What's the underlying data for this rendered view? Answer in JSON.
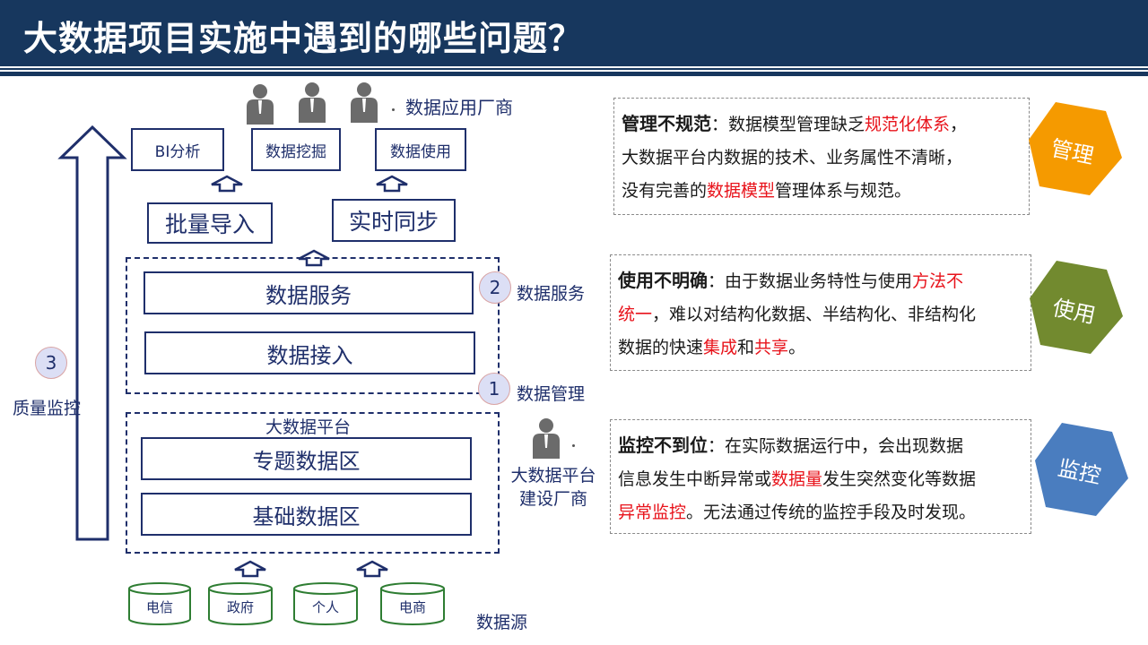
{
  "title": "大数据项目实施中遇到的哪些问题？",
  "diagram": {
    "vendor_app_label": "数据应用厂商",
    "apps": [
      "BI分析",
      "数据挖掘",
      "数据使用"
    ],
    "sync": [
      "批量导入",
      "实时同步"
    ],
    "service_box": "数据服务",
    "access_box": "数据接入",
    "platform_label": "大数据平台",
    "topic_box": "专题数据区",
    "base_box": "基础数据区",
    "sources": [
      "电信",
      "政府",
      "个人",
      "电商"
    ],
    "source_label": "数据源",
    "markers": [
      {
        "num": "2",
        "label": "数据服务"
      },
      {
        "num": "1",
        "label": "数据管理"
      },
      {
        "num": "3",
        "label": "质量监控"
      }
    ],
    "platform_vendor_label": "大数据平台建设厂商",
    "platform_vendor_lines": [
      "大数据平台",
      "建设厂商"
    ]
  },
  "issues": [
    {
      "keyword": "管理不规范",
      "sep": "：",
      "line1a": "数据模型管理缺乏",
      "line1red": "规范化体系",
      "line1b": "，",
      "line2": "大数据平台内数据的技术、业务属性不清晰，",
      "line3a": "没有完善的",
      "line3red": "数据模型",
      "line3b": "管理体系与规范。",
      "tag": "管理",
      "color": "#f59a00"
    },
    {
      "keyword": "使用不明确",
      "sep": "：",
      "line1a": "由于数据业务特性与使用",
      "line1red": "方法不",
      "line2red": "统一",
      "line2b": "，难以对结构化数据、半结构化、非结构化",
      "line3a": "数据的快速",
      "line3red": "集成",
      "line3b": "和",
      "line3red2": "共享",
      "line3c": "。",
      "tag": "使用",
      "color": "#728a2f"
    },
    {
      "keyword": "监控不到位",
      "sep": "：",
      "line1a": "在实际数据运行中，会出现数据",
      "line2a": "信息发生中断异常或",
      "line2red": "数据量",
      "line2b": "发生突然变化等数据",
      "line3red": "异常监控",
      "line3b": "。无法通过传统的监控手段及时发现。",
      "tag": "监控",
      "color": "#4a7dbf"
    }
  ],
  "colors": {
    "header_bg": "#17375e",
    "diagram_blue": "#1f2f6b",
    "highlight_red": "#e8131b",
    "db_green": "#2e7d32"
  }
}
